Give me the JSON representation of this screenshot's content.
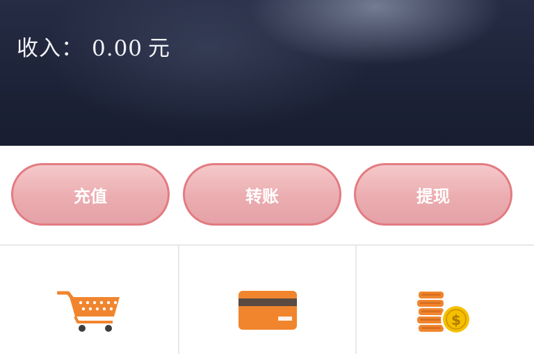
{
  "header": {
    "income_label": "收入：",
    "income_amount": "0.00",
    "income_unit": "元"
  },
  "actions": [
    {
      "label": "充值"
    },
    {
      "label": "转账"
    },
    {
      "label": "提现"
    }
  ],
  "features": [
    {
      "icon": "shopping-cart-icon",
      "color": "#f0852e"
    },
    {
      "icon": "bank-card-icon",
      "color": "#f0852e"
    },
    {
      "icon": "coins-icon",
      "color": "#f0852e"
    }
  ],
  "colors": {
    "banner": "#1d2338",
    "pill_border": "#e07077",
    "pill_fill": "#eaa6aa",
    "accent": "#f0852e",
    "coin_gold": "#f5c000"
  }
}
